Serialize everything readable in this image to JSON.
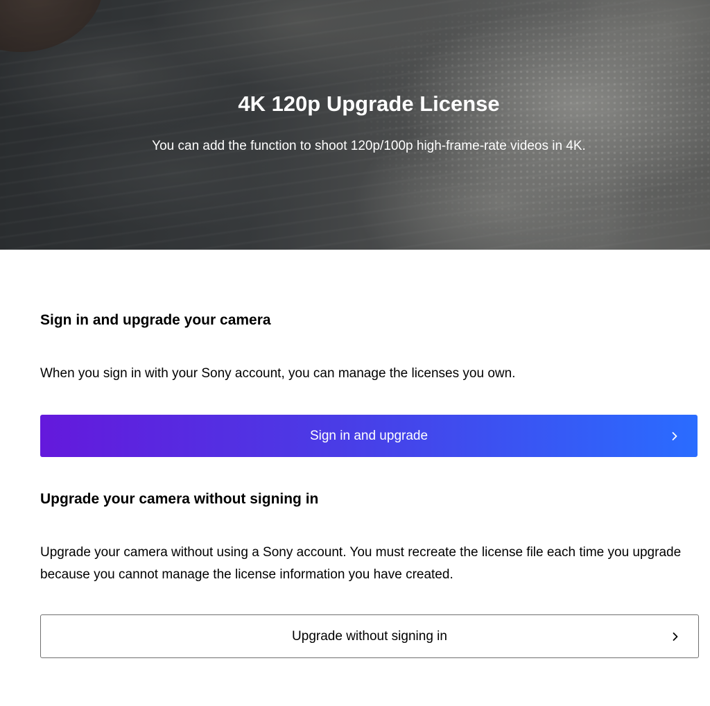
{
  "hero": {
    "title": "4K 120p Upgrade License",
    "subtitle": "You can add the function to shoot 120p/100p high-frame-rate videos in 4K."
  },
  "sign_in_section": {
    "heading": "Sign in and upgrade your camera",
    "description": "When you sign in with your Sony account, you can manage the licenses you own.",
    "button_label": "Sign in and upgrade",
    "button_icon": "chevron-right-icon"
  },
  "no_sign_in_section": {
    "heading": "Upgrade your camera without signing in",
    "description": "Upgrade your camera without using a Sony account. You must recreate the license file each time you upgrade because you cannot manage the license information you have created.",
    "button_label": "Upgrade without signing in",
    "button_icon": "chevron-right-icon"
  },
  "colors": {
    "primary_gradient_start": "#6419dc",
    "primary_gradient_end": "#2a6cff",
    "secondary_border": "#6e6e6e",
    "text": "#000000"
  }
}
